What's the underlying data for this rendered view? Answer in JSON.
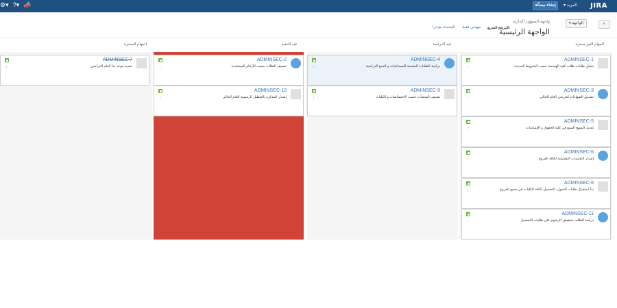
{
  "topbar": {
    "logo": "JIRA",
    "create_label": "إنشاء مسألة",
    "more_label": "المزيد",
    "left_icons": [
      "gear-icon",
      "help-icon",
      "megaphone-icon"
    ]
  },
  "header": {
    "breadcrumb": "واجهة الشؤون الإدارية",
    "title": "الواجهة الرئيسية",
    "quick_filter_label": "المرشح السريع:",
    "filters": [
      "مهمتي فقط",
      "المحدثة مؤخرا"
    ],
    "board_menu_label": "الواجهة",
    "collapse_label": "«"
  },
  "columns": [
    {
      "title": "المهام الغير منجزة",
      "cards": [
        {
          "key": "ADMINSEC-1",
          "summary": "تحليل طلبات طلاب كلية الهندسة حسب الشروط الجديدة",
          "avatar": "grey"
        },
        {
          "key": "ADMINSEC-3",
          "summary": "تصديق الشهادات لخريجي العام الحالي",
          "avatar": "blue"
        },
        {
          "key": "ADMINSEC-5",
          "summary": "تعديل المنهج المتبع في كلية الحقوق و الإنسانيات",
          "avatar": "grey"
        },
        {
          "key": "ADMINSEC-6",
          "summary": "إصدار التعليمات التفصيلية لكافة الفروع",
          "avatar": "blue"
        },
        {
          "key": "ADMINSEC-8",
          "summary": "بدأ استقبال طلبات التحول، التسجيل لكافة الكليات في جميع الفروع",
          "avatar": "grey"
        },
        {
          "key": "ADMINSEC-11",
          "summary": "دراسة الطلب بتخفيض الرسوم على طلبات التسجيل",
          "avatar": "blue"
        }
      ]
    },
    {
      "title": "قيد الدراسة",
      "cards": [
        {
          "key": "ADMINSEC-4",
          "summary": "دراسة الطلبات المقدمة للمساعدات و المنح الدراسية",
          "avatar": "blue"
        },
        {
          "key": "ADMINSEC-9",
          "summary": "تصنيف المنشآت حسب الإختصاصات و الكليات",
          "avatar": "grey"
        }
      ]
    },
    {
      "title": "قيد التنفيذ",
      "cards": [
        {
          "key": "ADMINSEC-2",
          "summary": "تصنيف الطلاب حسب الأرقام المستجدة",
          "avatar": "blue"
        },
        {
          "key": "ADMINSEC-10",
          "summary": "إصدار المذكرة بالتعطيل الرسمية للعام الحالي",
          "avatar": "grey"
        }
      ]
    },
    {
      "title": "المهام المنجزة",
      "cards": [
        {
          "key": "ADMINSEC-7",
          "summary": "تحديد موعد بدأ العام الدراسي",
          "avatar": "grey",
          "done": true
        }
      ]
    }
  ],
  "colors": {
    "topbar": "#205081",
    "link": "#3b73af",
    "story_icon": "#65b130",
    "priority_icon": "#f79232",
    "max_exceeded_column": "#d04437",
    "selected_card": "#ebf2f9"
  }
}
